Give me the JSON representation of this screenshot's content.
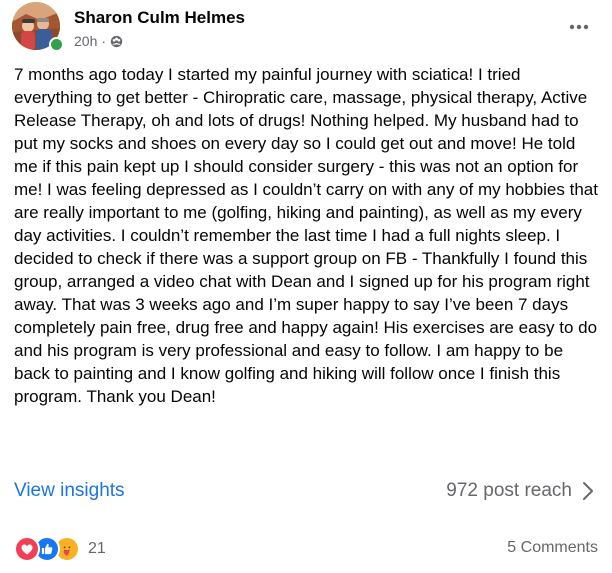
{
  "author": {
    "name": "Sharon Culm Helmes",
    "time": "20h",
    "separator": "·",
    "online": true
  },
  "post": {
    "text": "7 months ago today I started my painful journey with sciatica! I tried everything to get better - Chiropratic care, massage, physical therapy, Active Release Therapy, oh and lots of drugs!  Nothing helped. My husband had to put my socks and shoes on every day so I could get out and move! He told me if this pain kept up I should consider surgery - this was not an option for me!  I was feeling depressed as I couldn’t carry on with any of my hobbies that are really important to me (golfing, hiking and painting), as well as my every day activities. I couldn’t remember the last time I had a full nights sleep. I decided to check if there was a support group on FB - Thankfully I found this group, arranged a video chat with Dean and I signed up for his program right away. That was 3 weeks ago and I’m super happy to say I’ve been 7 days completely pain free, drug free and happy again!  His exercises are easy to do and his program is very professional and easy to follow.  I am happy to be back to painting and I know golfing and hiking will follow once I finish this program. Thank you Dean!"
  },
  "insights": {
    "link_label": "View insights",
    "reach_label": "972 post reach"
  },
  "footer": {
    "reaction_count": "21",
    "comments_label": "5 Comments",
    "reactions": [
      "love",
      "like",
      "care"
    ]
  },
  "icons": {
    "globe": "globe-icon",
    "more": "more-horizontal-icon",
    "chevron": "chevron-right-icon"
  },
  "colors": {
    "link": "#1b74e4",
    "secondary_text": "#65676b",
    "online": "#31a24c",
    "love": "#f33e58",
    "like": "#1877f2",
    "care": "#f7b125"
  }
}
